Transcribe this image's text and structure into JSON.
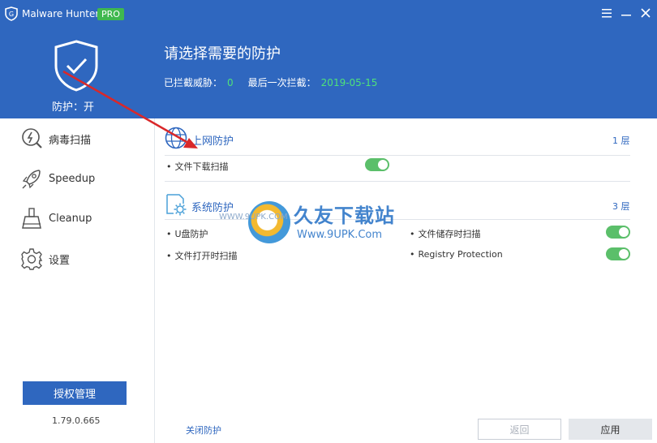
{
  "titlebar": {
    "app_name": "Malware Hunter",
    "badge": "PRO"
  },
  "header": {
    "protect_status": "防护：开",
    "headline": "请选择需要的防护",
    "blocked_label": "已拦截威胁：",
    "blocked_count": "0",
    "last_block_label": "最后一次拦截：",
    "last_block_date": "2019-05-15"
  },
  "sidebar": {
    "items": [
      {
        "label": "病毒扫描",
        "icon": "virus-scan-icon"
      },
      {
        "label": "Speedup",
        "icon": "rocket-icon"
      },
      {
        "label": "Cleanup",
        "icon": "broom-icon"
      },
      {
        "label": "设置",
        "icon": "gear-icon"
      }
    ],
    "license_button": "授权管理",
    "version": "1.79.0.665"
  },
  "sections": {
    "web": {
      "title": "上网防护",
      "layers": "1 层",
      "icon": "globe-icon",
      "items": [
        {
          "label": "文件下载扫描",
          "enabled": true
        }
      ]
    },
    "system": {
      "title": "系统防护",
      "layers": "3 层",
      "icon": "system-settings-icon",
      "items": [
        {
          "label": "U盘防护",
          "enabled": false
        },
        {
          "label": "文件储存时扫描",
          "enabled": true
        },
        {
          "label": "文件打开时扫描",
          "enabled": false
        },
        {
          "label": "Registry Protection",
          "enabled": true
        }
      ]
    }
  },
  "footer": {
    "disable_link": "关闭防护",
    "back_button": "返回",
    "apply_button": "应用"
  },
  "watermark": {
    "small": "WWW.9UPK.COM",
    "big": "久友下载站",
    "url": "Www.9UPK.Com"
  },
  "colors": {
    "brand_blue": "#2f67bf",
    "toggle_on": "#5bbf6a",
    "date_green": "#4fe27a",
    "annotation_red": "#d9282a"
  }
}
